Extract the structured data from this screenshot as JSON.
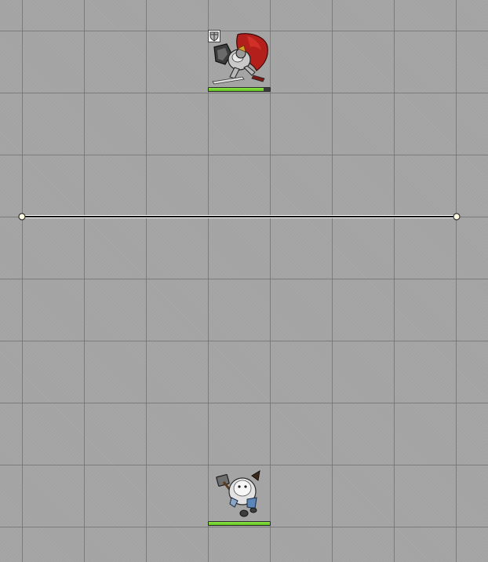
{
  "scene": {
    "grid_color": "#6e6e6e",
    "background_color": "#a3a3a3"
  },
  "tokens": [
    {
      "name": "knight",
      "icon": "armored-knight-red-cape",
      "status_marker": "shield-icon",
      "hp_fraction": 0.9,
      "hp_color": "#6fd12a"
    },
    {
      "name": "dwarf",
      "icon": "white-bearded-dwarf-with-hammer",
      "hp_fraction": 1.0,
      "hp_color": "#6fd12a"
    }
  ],
  "wall": {
    "color": "#111111",
    "endpoint_color": "#fffbe0"
  }
}
